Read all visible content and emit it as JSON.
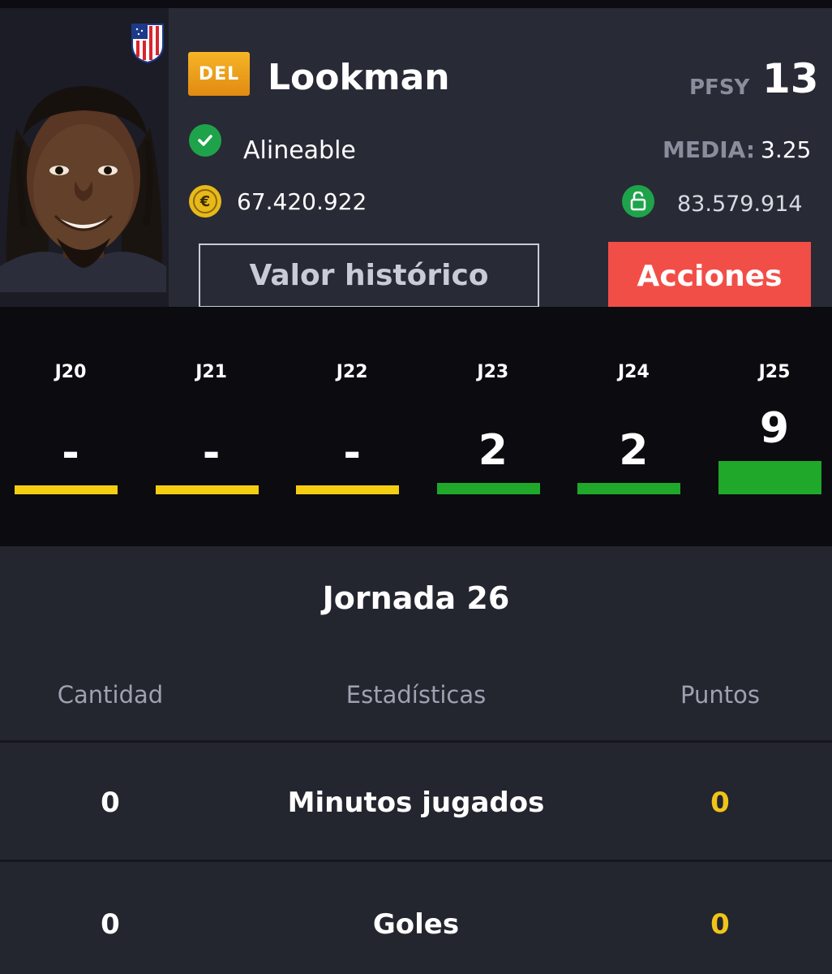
{
  "player": {
    "position": "DEL",
    "name": "Lookman",
    "pfsy_label": "PFSY",
    "pfsy_value": "13",
    "status": "Alineable",
    "media_label": "MEDIA:",
    "media_value": "3.25",
    "market_value": "67.420.922",
    "clause_value": "83.579.914"
  },
  "icons": {
    "status": "check-circle-icon",
    "value": "euro-coin-icon",
    "clause": "unlock-icon",
    "crest": "club-crest-icon"
  },
  "buttons": {
    "historic": "Valor histórico",
    "actions": "Acciones"
  },
  "rounds": [
    {
      "label": "J20",
      "points": "-",
      "status": "none"
    },
    {
      "label": "J21",
      "points": "-",
      "status": "none"
    },
    {
      "label": "J22",
      "points": "-",
      "status": "none"
    },
    {
      "label": "J23",
      "points": "2",
      "status": "played"
    },
    {
      "label": "J24",
      "points": "2",
      "status": "played"
    },
    {
      "label": "J25",
      "points": "9",
      "status": "played"
    }
  ],
  "colors": {
    "accent_red": "#f24e48",
    "played_green": "#1fa82a",
    "no_play_yellow": "#f5cd12",
    "points_yellow": "#f0c419"
  },
  "stats": {
    "title": "Jornada 26",
    "headers": {
      "quantity": "Cantidad",
      "stat": "Estadísticas",
      "points": "Puntos"
    },
    "rows": [
      {
        "quantity": "0",
        "stat": "Minutos jugados",
        "points": "0"
      },
      {
        "quantity": "0",
        "stat": "Goles",
        "points": "0"
      }
    ]
  }
}
